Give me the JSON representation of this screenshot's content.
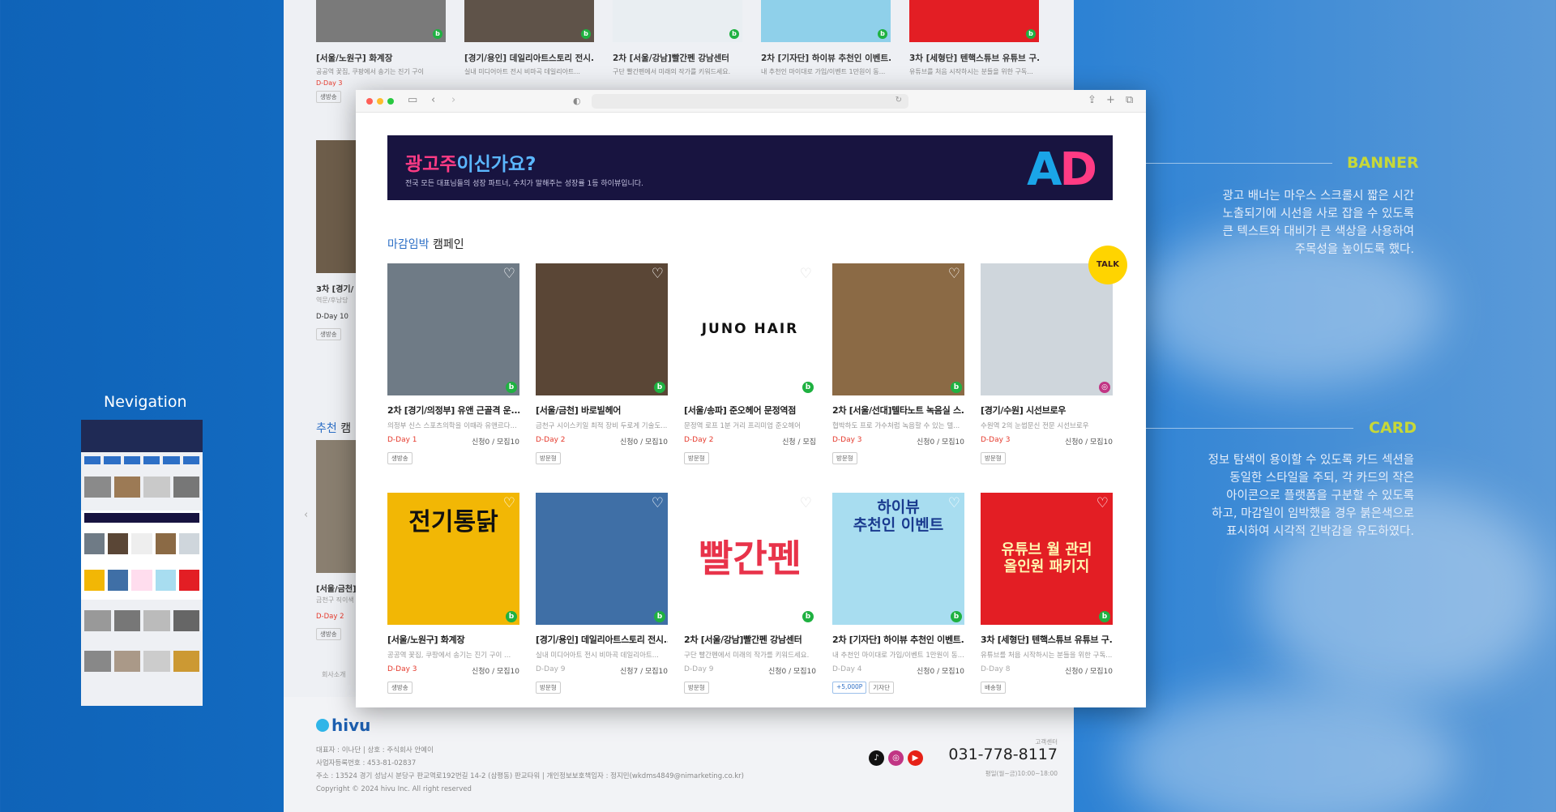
{
  "nav_label": "Nevigation",
  "annotations": {
    "banner": {
      "title": "BANNER",
      "lines": [
        "광고 배너는 마우스 스크롤시 짧은 시간",
        "노출되기에 시선을 사로 잡을 수 있도록",
        "큰 텍스트와 대비가 큰 색상을 사용하여",
        "주목성을 높이도록 했다."
      ]
    },
    "card": {
      "title": "CARD",
      "lines": [
        "정보 탐색이 용이할 수 있도록 카드 섹션을",
        "동일한 스타일을 주되, 각 카드의 작은",
        "아이콘으로 플랫폼을 구분할 수 있도록",
        "하고, 마감일이 임박했을 경우 붉은색으로",
        "표시하여 시각적 긴박감을 유도하였다."
      ]
    }
  },
  "bg_page": {
    "top_cards": [
      {
        "title": "[서울/노원구] 화계장",
        "desc": "공공역 꽃집, 쿠팡에서 송기는 진기 구이",
        "dday": "D-Day 3",
        "tag": "생방송"
      },
      {
        "title": "[경기/용인] 데일리아트스토리 전시...",
        "desc": "실내 미디어아트 전시 비마곡 데일리아트...",
        "dday": "",
        "tag": ""
      },
      {
        "title": "2차 [서울/강남]빨간펜 강남센터",
        "desc": "구단 빨간펜에서 미래의 작가를 키워드세요.",
        "dday": "",
        "tag": ""
      },
      {
        "title": "2차 [기자단] 하이뷰 추천인 이벤트...",
        "desc": "내 추천인 마이대로 가입/이벤트 1만원이 동...",
        "dday": "",
        "tag": ""
      },
      {
        "title": "3차 [세형단] 텐핵스튜브 유튜브 구...",
        "desc": "유튜브를 처음 시작하시는 분들을 위한 구독...",
        "dday": "",
        "tag": ""
      }
    ],
    "left_snips": [
      {
        "title": "3차 [경기/",
        "desc": "역문/후남당",
        "dday": "D-Day 10",
        "tag": "생방송"
      },
      {
        "title": "[서울/금천]",
        "desc": "금천구 직이색",
        "dday": "D-Day 2",
        "tag": "생방송"
      }
    ],
    "recommend_title": "추천 캠",
    "recommend_accent": "추천",
    "footer_link": "회사소개",
    "footer": {
      "logo": "hivu",
      "line1": "대표자 : 이나단  |  상호 : 주식회사 안예이",
      "line2": "사업자등록번호 : 453-81-02837",
      "line3": "주소 : 13524 경기 성남시 분당구 판교역로192번길 14-2 (삼평동) 판교타워  |  개인정보보호책임자 : 정지민(wkdms4849@nimarketing.co.kr)",
      "line4": "Copyright © 2024 hivu Inc. All right reserved",
      "cs": "고객센터",
      "phone": "031-778-8117",
      "hours": "평일(월~금)10:00~18:00"
    }
  },
  "banner": {
    "prefix": "광고주",
    "suffix": "이신가요?",
    "sub": "전국 모든 대표님들의 성장 파트너, 수치가 말해주는 성장률 1등 하이뷰입니다.",
    "logo_a": "A",
    "logo_d": "D"
  },
  "section": {
    "accent": "마감임박",
    "title": "캠페인"
  },
  "talk": "TALK",
  "cards_row1": [
    {
      "title": "2차 [경기/의정부] 유앤 근골격 운...",
      "desc": "의정부 신스 스포츠의학을 이때라 유앤르다...",
      "dday": "D-Day 1",
      "count": "신청0  / 모집10",
      "tag": "생방송",
      "platform": "b",
      "color": "#6f7b86"
    },
    {
      "title": "[서울/금천] 바로빌헤어",
      "desc": "금천구 시이스키일 최적 장비 두로게 기술도...",
      "dday": "D-Day 2",
      "count": "신청0  / 모집10",
      "tag": "방문형",
      "platform": "b",
      "color": "#5a4636"
    },
    {
      "title": "[서울/송파] 준오헤어 문정역점",
      "desc": "문정역 로프 1분 거리 프리미엄 준오헤어",
      "dday": "D-Day 2",
      "count": "신청  / 모집",
      "tag": "방문형",
      "platform": "b",
      "color": "#ffffff",
      "label": "JUNO HAIR"
    },
    {
      "title": "2차 [서울/선대]텔타노트 녹음실 스...",
      "desc": "협박하도 프로 가수처럼 녹음할 수 있는 텔...",
      "dday": "D-Day 3",
      "count": "신청0  / 모집10",
      "tag": "방문형",
      "platform": "b",
      "color": "#8b6a45"
    },
    {
      "title": "[경기/수원] 시선브로우",
      "desc": "수원역 2의 눈썹문신 전문 시선브로우",
      "dday": "D-Day 3",
      "count": "신청0  / 모집10",
      "tag": "방문형",
      "platform": "instagram",
      "color": "#cfd6dc"
    }
  ],
  "cards_row2": [
    {
      "title": "[서울/노원구] 화계장",
      "desc": "공공역 꽃집, 쿠팡에서 송기는 진기 구이 ...",
      "dday": "D-Day 3",
      "count": "신청0  / 모집10",
      "tag": "생방송",
      "platform": "b",
      "color": "#f2b705",
      "label": "전기통닭"
    },
    {
      "title": "[경기/용인] 데일리아트스토리 전시...",
      "desc": "실내 미디어아트 전시 비마곡 데일리아트...",
      "dday": "D-Day 9",
      "count": "신청7  / 모집10",
      "tag": "방문형",
      "platform": "b",
      "color": "#3f6fa6"
    },
    {
      "title": "2차 [서울/강남]빨간펜 강남센터",
      "desc": "구단 빨간펜에서 미래의 작가를 키워드세요.",
      "dday": "D-Day 9",
      "count": "신청0  / 모집10",
      "tag": "방문형",
      "platform": "b",
      "color": "#ffffff",
      "label": "빨간펜"
    },
    {
      "title": "2차 [기자단] 하이뷰 추천인 이벤트...",
      "desc": "내 추천인 마이대로 가입/이벤트 1만원이 동...",
      "dday": "D-Day 4",
      "count": "신청0  / 모집10",
      "tag": "+5,000P",
      "tag2": "기자단",
      "platform": "b",
      "color": "#a8ddf0",
      "label": "하이뷰\n추천인 이벤트"
    },
    {
      "title": "3차 [세형단] 텐핵스튜브 유튜브 구...",
      "desc": "유튜브를 처음 시작하시는 분들을 위한 구독...",
      "dday": "D-Day 8",
      "count": "신청0  / 모집10",
      "tag": "배송형",
      "platform": "b",
      "color": "#e31e24",
      "label": "유튜브 월 관리\n올인원 패키지"
    }
  ],
  "colors": {
    "brand": "#1d5fb0",
    "dday": "#e5392c",
    "naver": "#1fb141",
    "banner_bg": "#181440",
    "accent_label": "#c7d838"
  }
}
